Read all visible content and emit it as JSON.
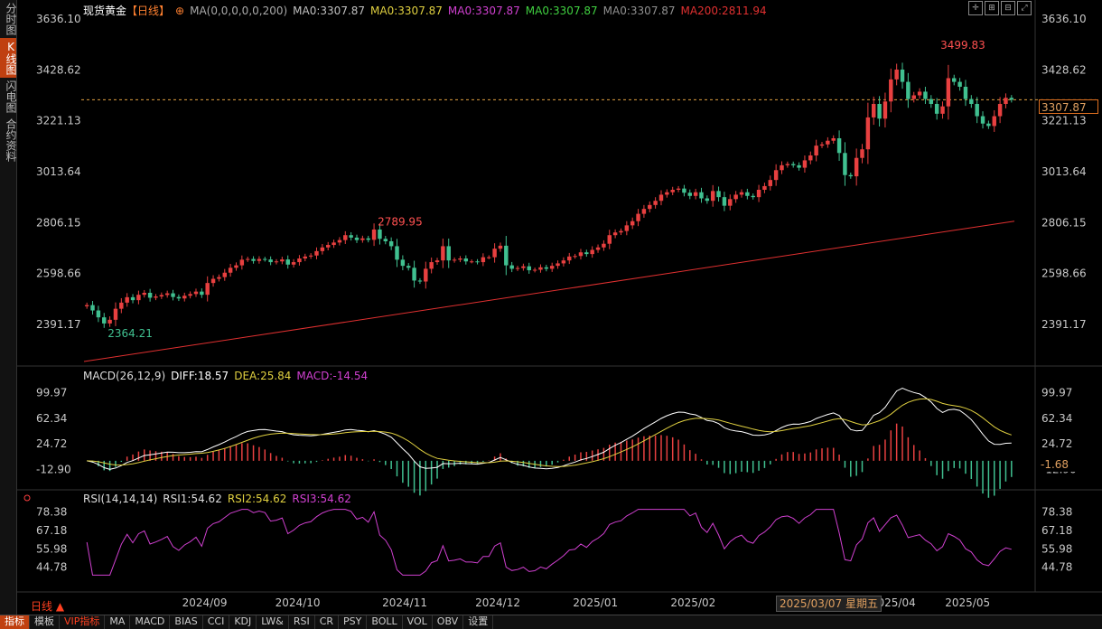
{
  "sidebar": {
    "items": [
      {
        "label": "分时图",
        "active": false
      },
      {
        "label": "K线图",
        "active": true
      },
      {
        "label": "闪电图",
        "active": false
      },
      {
        "label": "合约资料",
        "active": false
      }
    ]
  },
  "legend_k": {
    "name": "现货黄金",
    "period": "【日线】",
    "ma_params": "MA(0,0,0,0,0,200)",
    "ma1": "MA0:3307.87",
    "ma2": "MA0:3307.87",
    "ma3": "MA0:3307.87",
    "ma4": "MA0:3307.87",
    "ma5": "MA0:3307.87",
    "ma200": "MA200:2811.94"
  },
  "legend_macd": {
    "name": "MACD(26,12,9)",
    "diff": "DIFF:18.57",
    "dea": "DEA:25.84",
    "macd": "MACD:-14.54"
  },
  "legend_rsi": {
    "name": "RSI(14,14,14)",
    "rsi1": "RSI1:54.62",
    "rsi2": "RSI2:54.62",
    "rsi3": "RSI3:54.62"
  },
  "current_price": "3307.87",
  "macd_current": "-1.68",
  "date_tip": "2025/03/07 星期五",
  "period_button": "日线 ▲",
  "bottom_tabs": [
    "指标",
    "模板",
    "VIP指标",
    "MA",
    "MACD",
    "BIAS",
    "CCI",
    "KDJ",
    "LW&",
    "RSI",
    "CR",
    "PSY",
    "BOLL",
    "VOL",
    "OBV",
    "设置"
  ],
  "colors": {
    "up": "#e84040",
    "down": "#40c090",
    "ma200": "#e03030",
    "diff": "#ffffff",
    "dea": "#e0d040",
    "rsi": "#d040d0"
  },
  "chart_data": [
    {
      "type": "candlestick",
      "title": "现货黄金 日线",
      "ylim": [
        2240,
        3640
      ],
      "y_ticks": [
        "3636.10",
        "3428.62",
        "3221.13",
        "3013.64",
        "2806.15",
        "2598.66",
        "2391.17"
      ],
      "x_ticks": [
        "2024/09",
        "2024/10",
        "2024/11",
        "2024/12",
        "2025/01",
        "2025/02",
        "2025/04",
        "2025/05"
      ],
      "annotations": {
        "high": "3499.83",
        "mid_high": "2789.95",
        "low": "2364.21"
      },
      "close_series": [
        2470,
        2448,
        2420,
        2395,
        2410,
        2455,
        2480,
        2502,
        2490,
        2512,
        2520,
        2500,
        2505,
        2511,
        2518,
        2503,
        2497,
        2508,
        2515,
        2525,
        2512,
        2560,
        2577,
        2584,
        2602,
        2622,
        2632,
        2655,
        2658,
        2650,
        2658,
        2656,
        2645,
        2648,
        2656,
        2635,
        2645,
        2660,
        2668,
        2672,
        2690,
        2705,
        2715,
        2725,
        2735,
        2755,
        2745,
        2735,
        2742,
        2736,
        2778,
        2740,
        2730,
        2710,
        2655,
        2630,
        2622,
        2570,
        2566,
        2618,
        2645,
        2652,
        2710,
        2652,
        2655,
        2660,
        2648,
        2648,
        2645,
        2665,
        2665,
        2700,
        2712,
        2632,
        2618,
        2621,
        2628,
        2612,
        2614,
        2624,
        2618,
        2630,
        2640,
        2652,
        2668,
        2670,
        2685,
        2678,
        2695,
        2705,
        2720,
        2755,
        2766,
        2772,
        2795,
        2812,
        2842,
        2862,
        2878,
        2895,
        2920,
        2930,
        2940,
        2945,
        2928,
        2915,
        2930,
        2905,
        2895,
        2935,
        2910,
        2875,
        2902,
        2920,
        2930,
        2915,
        2910,
        2940,
        2955,
        2980,
        3020,
        3040,
        3045,
        3040,
        3030,
        3060,
        3080,
        3120,
        3125,
        3140,
        3150,
        3090,
        3000,
        2995,
        3070,
        3105,
        3235,
        3290,
        3230,
        3300,
        3390,
        3430,
        3380,
        3310,
        3325,
        3340,
        3310,
        3290,
        3250,
        3280,
        3395,
        3380,
        3360,
        3310,
        3290,
        3240,
        3210,
        3200,
        3240,
        3290,
        3315,
        3307
      ]
    },
    {
      "type": "line",
      "name": "MA200",
      "ma200_start": 2240,
      "ma200_end": 2811.94
    },
    {
      "type": "macd",
      "ylim": [
        -40,
        110
      ],
      "y_ticks": [
        "99.97",
        "62.34",
        "24.72",
        "-12.90"
      ]
    },
    {
      "type": "line",
      "name": "RSI",
      "ylim": [
        38,
        82
      ],
      "y_ticks": [
        "78.38",
        "67.18",
        "55.98",
        "44.78"
      ]
    }
  ]
}
